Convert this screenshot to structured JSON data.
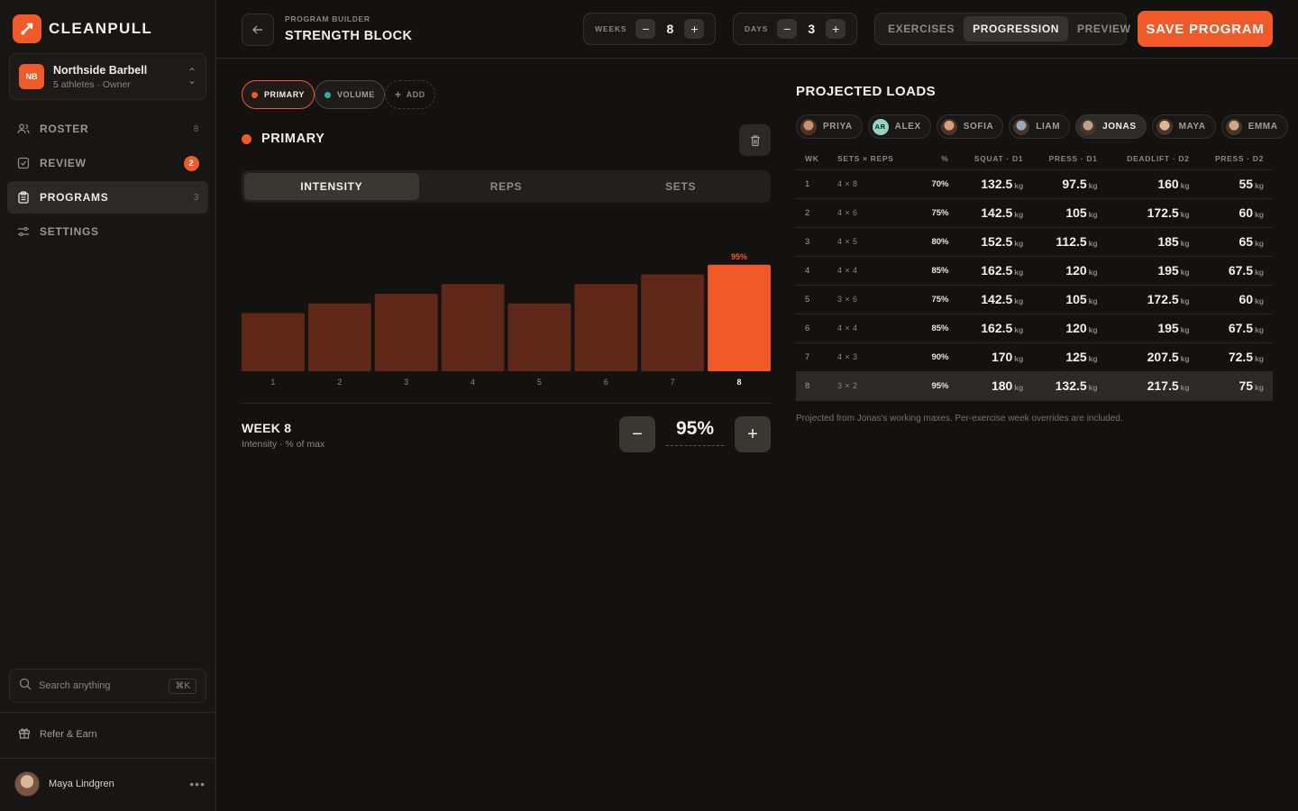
{
  "brand": {
    "name": "CLEANPULL"
  },
  "team": {
    "badge": "NB",
    "name": "Northside Barbell",
    "sub": "5 athletes · Owner"
  },
  "nav": [
    {
      "label": "ROSTER",
      "count": "8"
    },
    {
      "label": "REVIEW",
      "badge": "2"
    },
    {
      "label": "PROGRAMS",
      "count": "3"
    },
    {
      "label": "SETTINGS"
    }
  ],
  "search": {
    "placeholder": "Search anything",
    "shortcut": "⌘K"
  },
  "refer": "Refer & Earn",
  "user": {
    "name": "Maya Lindgren"
  },
  "header": {
    "eyebrow": "PROGRAM BUILDER",
    "title": "STRENGTH BLOCK",
    "weeks_label": "WEEKS",
    "weeks": "8",
    "days_label": "DAYS",
    "days": "3",
    "tabs": [
      "EXERCISES",
      "PROGRESSION",
      "PREVIEW"
    ],
    "active_tab": "PROGRESSION",
    "save": "SAVE PROGRAM"
  },
  "blocks": {
    "chips": [
      {
        "label": "PRIMARY",
        "color": "#f05a28"
      },
      {
        "label": "VOLUME",
        "color": "#2bb3a0"
      },
      {
        "label": "ADD"
      }
    ],
    "section": "PRIMARY"
  },
  "metric_tabs": [
    "INTENSITY",
    "REPS",
    "SETS"
  ],
  "chart_data": {
    "type": "bar",
    "categories": [
      "1",
      "2",
      "3",
      "4",
      "5",
      "6",
      "7",
      "8"
    ],
    "values": [
      70,
      75,
      80,
      85,
      75,
      85,
      90,
      95
    ],
    "selected": "8",
    "selected_label": "95%",
    "colors": {
      "bar": "#5e2718",
      "selected": "#f05a28"
    }
  },
  "week_editor": {
    "title": "WEEK 8",
    "sub": "Intensity · % of max",
    "value": "95%"
  },
  "projected": {
    "title": "PROJECTED LOADS",
    "athletes": [
      {
        "name": "PRIYA",
        "color": "#c89070"
      },
      {
        "name": "ALEX",
        "initials": "AR",
        "color": "#8fd4c4"
      },
      {
        "name": "SOFIA",
        "color": "#d6a07a"
      },
      {
        "name": "LIAM",
        "color": "#9aa7c0"
      },
      {
        "name": "JONAS",
        "color": "#b8a48e",
        "active": true
      },
      {
        "name": "MAYA",
        "color": "#d9b79a"
      },
      {
        "name": "EMMA",
        "color": "#c9a88c"
      }
    ],
    "columns": [
      "WK",
      "SETS × REPS",
      "%",
      "SQUAT · D1",
      "PRESS · D1",
      "DEADLIFT · D2",
      "PRESS · D2"
    ],
    "unit": "kg",
    "rows": [
      {
        "wk": "1",
        "sr": "4 × 8",
        "pct": "70%",
        "vals": [
          "132.5",
          "97.5",
          "160",
          "55"
        ]
      },
      {
        "wk": "2",
        "sr": "4 × 6",
        "pct": "75%",
        "vals": [
          "142.5",
          "105",
          "172.5",
          "60"
        ]
      },
      {
        "wk": "3",
        "sr": "4 × 5",
        "pct": "80%",
        "vals": [
          "152.5",
          "112.5",
          "185",
          "65"
        ]
      },
      {
        "wk": "4",
        "sr": "4 × 4",
        "pct": "85%",
        "vals": [
          "162.5",
          "120",
          "195",
          "67.5"
        ]
      },
      {
        "wk": "5",
        "sr": "3 × 6",
        "pct": "75%",
        "vals": [
          "142.5",
          "105",
          "172.5",
          "60"
        ]
      },
      {
        "wk": "6",
        "sr": "4 × 4",
        "pct": "85%",
        "vals": [
          "162.5",
          "120",
          "195",
          "67.5"
        ]
      },
      {
        "wk": "7",
        "sr": "4 × 3",
        "pct": "90%",
        "vals": [
          "170",
          "125",
          "207.5",
          "72.5"
        ]
      },
      {
        "wk": "8",
        "sr": "3 × 2",
        "pct": "95%",
        "vals": [
          "180",
          "132.5",
          "217.5",
          "75"
        ],
        "highlight": true
      }
    ],
    "note": "Projected from Jonas's working maxes. Per-exercise week overrides are included."
  }
}
